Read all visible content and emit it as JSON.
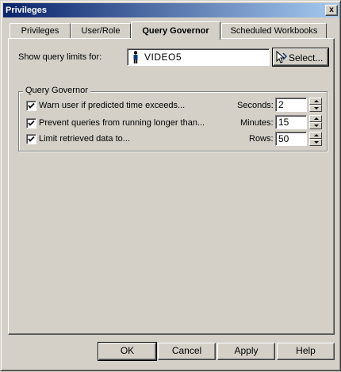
{
  "window": {
    "title": "Privileges",
    "close_label": "x"
  },
  "tabs": [
    {
      "label": "Privileges",
      "active": false
    },
    {
      "label": "User/Role",
      "active": false
    },
    {
      "label": "Query Governor",
      "active": true
    },
    {
      "label": "Scheduled Workbooks",
      "active": false
    }
  ],
  "query_limits": {
    "label": "Show query limits for:",
    "user_value": "VIDEO5",
    "user_icon": "person-icon",
    "select_button": "Select..."
  },
  "governor": {
    "title": "Query Governor",
    "rows": [
      {
        "checkbox_label": "Warn user if predicted time exceeds...",
        "checked": true,
        "unit_label": "Seconds:",
        "value": "2"
      },
      {
        "checkbox_label": "Prevent queries from running longer than...",
        "checked": true,
        "unit_label": "Minutes:",
        "value": "15"
      },
      {
        "checkbox_label": "Limit retrieved data to...",
        "checked": true,
        "unit_label": "Rows:",
        "value": "50"
      }
    ]
  },
  "buttons": {
    "ok": "OK",
    "cancel": "Cancel",
    "apply": "Apply",
    "help": "Help"
  }
}
